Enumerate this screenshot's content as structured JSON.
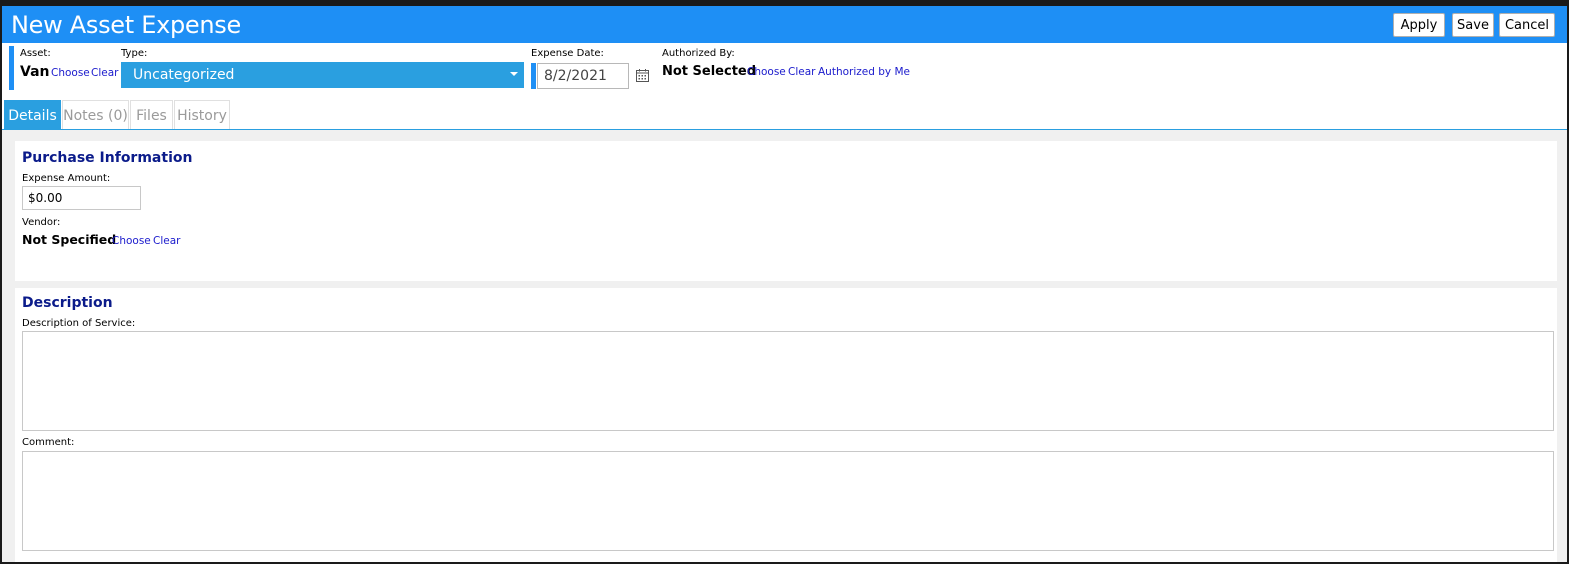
{
  "window": {
    "title": "New Asset Expense",
    "buttons": {
      "apply": "Apply",
      "save": "Save",
      "cancel": "Cancel"
    },
    "accent_color": "#1e8ff5"
  },
  "header": {
    "asset": {
      "label": "Asset:",
      "value": "Van",
      "choose": "Choose",
      "clear": "Clear"
    },
    "type": {
      "label": "Type:",
      "selected": "Uncategorized",
      "icon": "chevron-down-icon"
    },
    "expense_date": {
      "label": "Expense Date:",
      "value": "8/2/2021",
      "icon": "calendar-icon"
    },
    "authorized_by": {
      "label": "Authorized By:",
      "value": "Not Selected",
      "choose": "Choose",
      "clear": "Clear",
      "authorized_by_me": "Authorized by Me"
    }
  },
  "tabs": [
    {
      "label": "Details",
      "active": true
    },
    {
      "label": "Notes (0)",
      "active": false
    },
    {
      "label": "Files",
      "active": false
    },
    {
      "label": "History",
      "active": false
    }
  ],
  "purchase_information": {
    "title": "Purchase Information",
    "expense_amount_label": "Expense Amount:",
    "expense_amount_value": "$0.00",
    "vendor_label": "Vendor:",
    "vendor_value": "Not Specified",
    "vendor_choose": "Choose",
    "vendor_clear": "Clear"
  },
  "description": {
    "title": "Description",
    "description_of_service_label": "Description of Service:",
    "description_of_service_value": "",
    "comment_label": "Comment:",
    "comment_value": ""
  }
}
